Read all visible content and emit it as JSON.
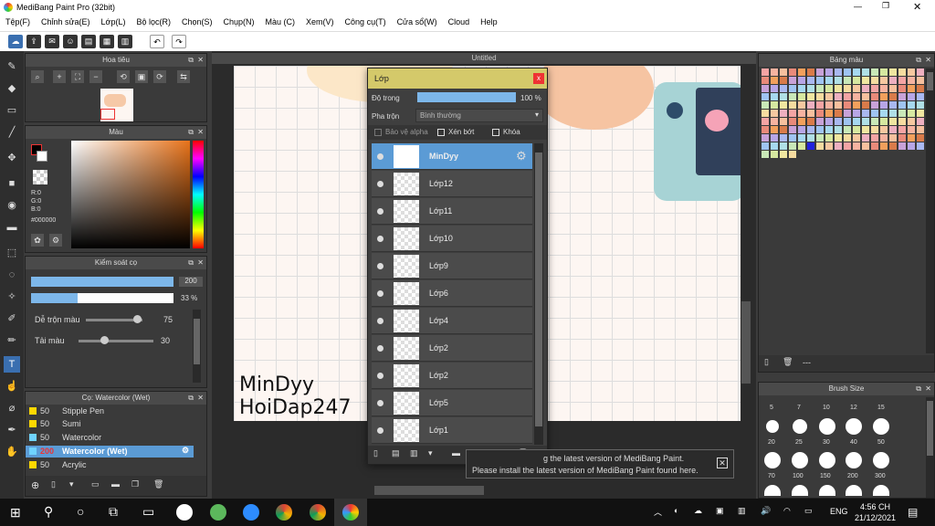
{
  "app": {
    "title": "MediBang Paint Pro (32bit)"
  },
  "menu": [
    "Tệp(F)",
    "Chỉnh sửa(E)",
    "Lớp(L)",
    "Bộ lọc(R)",
    "Chọn(S)",
    "Chụp(N)",
    "Màu (C)",
    "Xem(V)",
    "Công cụ(T)",
    "Cửa sổ(W)",
    "Cloud",
    "Help"
  ],
  "navigator": {
    "title": "Hoa tiêu"
  },
  "color": {
    "title": "Màu",
    "r": "R:0",
    "g": "G:0",
    "b": "B:0",
    "hex": "#000000"
  },
  "brushctrl": {
    "title": "Kiểm soát cọ",
    "size": "200",
    "opacity": "33 %",
    "blend_label": "Dễ trộn màu",
    "blend_value": "75",
    "color_label": "Tải màu",
    "color_value": "30"
  },
  "brushes": {
    "title": "Cọ: Watercolor (Wet)",
    "items": [
      {
        "size": "50",
        "name": "Stipple Pen"
      },
      {
        "size": "50",
        "name": "Sumi"
      },
      {
        "size": "50",
        "name": "Watercolor"
      },
      {
        "size": "200",
        "name": "Watercolor (Wet)"
      },
      {
        "size": "50",
        "name": "Acrylic"
      }
    ]
  },
  "canvas": {
    "tab": "Untitled",
    "watermark1": "MinDyy",
    "watermark2": "HoiDap247"
  },
  "layers": {
    "title": "Lớp",
    "opacity_label": "Độ trong",
    "opacity_value": "100 %",
    "blend_label": "Pha trộn",
    "blend_value": "Bình thường",
    "protect_alpha": "Bảo vệ alpha",
    "clip": "Xén bớt",
    "lock": "Khóa",
    "close": "x",
    "items": [
      "MinDyy",
      "Lớp12",
      "Lớp11",
      "Lớp10",
      "Lớp9",
      "Lớp6",
      "Lớp4",
      "Lớp2",
      "Lớp2",
      "Lớp5",
      "Lớp1"
    ]
  },
  "notice": {
    "line1": "g the latest version of MediBang Paint.",
    "line2": "Please install the latest version of MediBang Paint found here."
  },
  "palette": {
    "title": "Bảng màu",
    "footer": "---"
  },
  "brushsize": {
    "title": "Brush Size",
    "row1": [
      "5",
      "7",
      "10",
      "12",
      "15"
    ],
    "row2": [
      "20",
      "25",
      "30",
      "40",
      "50"
    ],
    "row3": [
      "70",
      "100",
      "150",
      "200",
      "300"
    ]
  },
  "taskbar": {
    "lang": "ENG",
    "time": "4:56 CH",
    "date": "21/12/2021"
  }
}
